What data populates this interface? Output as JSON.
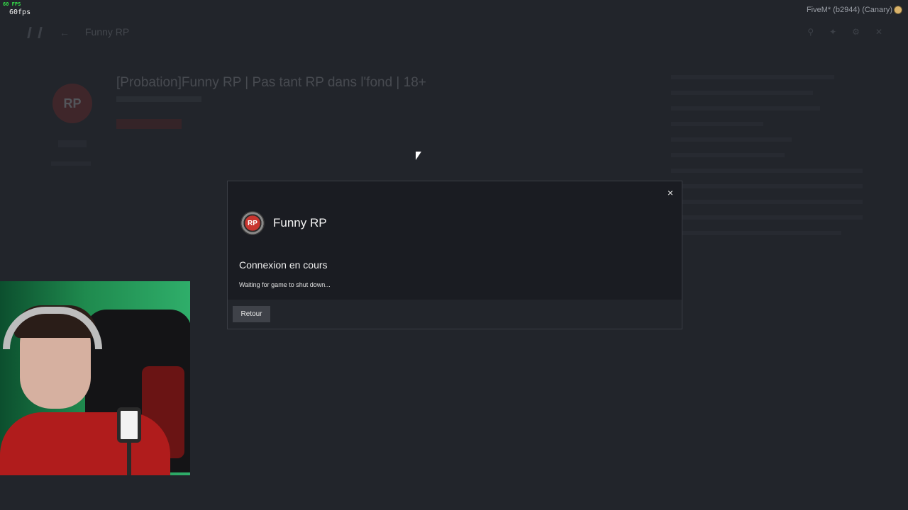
{
  "overlay": {
    "fps_small": "60 FPS",
    "fps": "60fps",
    "build_label": "FiveM* (b2944) (Canary)"
  },
  "background": {
    "nav_title": "Funny RP",
    "server_title": "[Probation]Funny RP | Pas tant RP dans l'fond | 18+"
  },
  "modal": {
    "server_logo_text": "RP",
    "server_name": "Funny RP",
    "status_title": "Connexion en cours",
    "status_message": "Waiting for game to shut down...",
    "back_label": "Retour",
    "close_symbol": "×"
  },
  "icons": {
    "close": "close-icon",
    "build": "fivem-canary-icon",
    "cursor": "mouse-cursor-icon"
  }
}
